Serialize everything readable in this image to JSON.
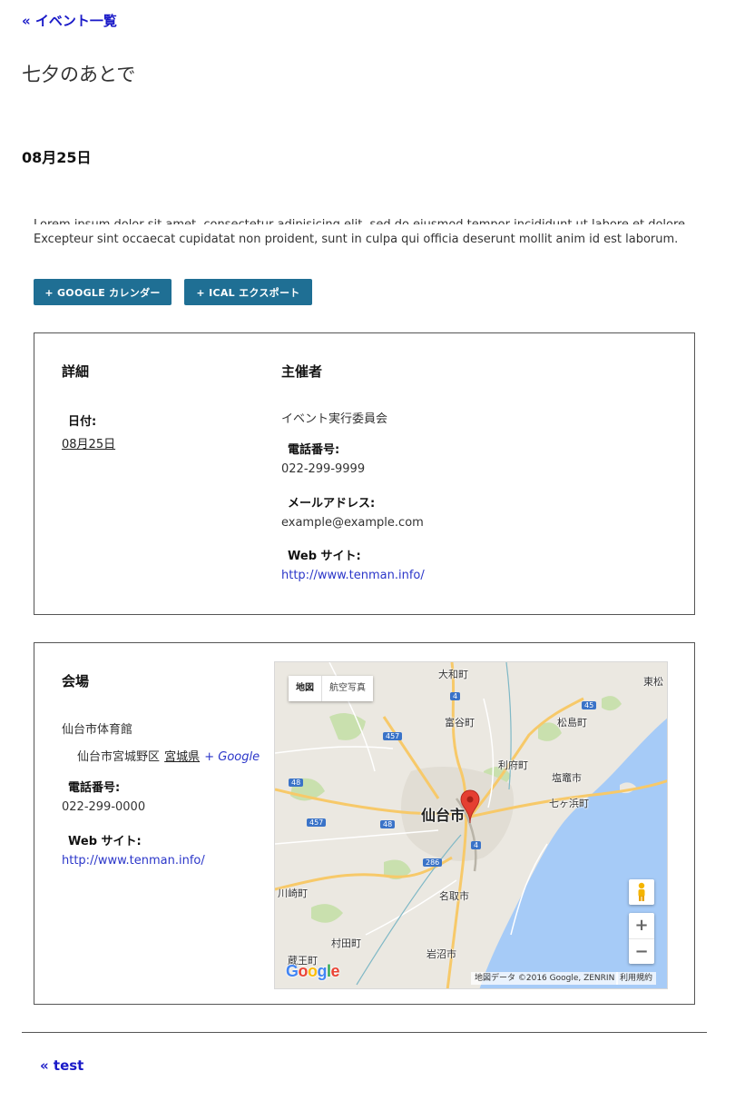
{
  "nav": {
    "back_label": "« イベント一覧",
    "footer_label": "« test"
  },
  "event": {
    "title": "七夕のあとで",
    "date_heading": "08月25日",
    "description_line1": "Lorem ipsum dolor sit amet, consectetur adipisicing elit, sed do eiusmod tempor incididunt ut labore et dolore",
    "description_line2": "Excepteur sint occaecat cupidatat non proident, sunt in culpa qui officia deserunt mollit anim id est laborum."
  },
  "buttons": {
    "gcal": "+ GOOGLE カレンダー",
    "ical": "+ ICAL エクスポート"
  },
  "details": {
    "heading": "詳細",
    "date_label": "日付:",
    "date_value": "08月25日"
  },
  "organizer": {
    "heading": "主催者",
    "name": "イベント実行委員会",
    "phone_label": "電話番号:",
    "phone": "022-299-9999",
    "email_label": "メールアドレス:",
    "email": "example@example.com",
    "website_label": "Web サイト:",
    "website": "http://www.tenman.info/"
  },
  "venue": {
    "heading": "会場",
    "name": "仙台市体育館",
    "address": "仙台市宮城野区",
    "prefecture": "宮城県",
    "gmap_link": "+ Google",
    "phone_label": "電話番号:",
    "phone": "022-299-0000",
    "website_label": "Web サイト:",
    "website": "http://www.tenman.info/"
  },
  "map": {
    "type_map": "地図",
    "type_satellite": "航空写真",
    "attribution": "地図データ ©2016 Google, ZENRIN",
    "terms": "利用規約",
    "labels": {
      "owari": "大和町",
      "tomiya": "富谷町",
      "higashimatsushima": "東松",
      "matsushima": "松島町",
      "rifu": "利府町",
      "shiogama": "塩竈市",
      "shichigahama": "七ヶ浜町",
      "sendai": "仙台市",
      "natori": "名取市",
      "kawasaki": "川崎町",
      "murata": "村田町",
      "zao": "蔵王町",
      "iwanuma": "岩沼市"
    },
    "route_numbers": [
      "4",
      "45",
      "457",
      "48",
      "457",
      "48",
      "286",
      "4"
    ],
    "colors": {
      "water": "#a6cbf7",
      "land": "#ebe8e1",
      "road_major": "#f7c969",
      "road_minor": "#ffffff",
      "green": "#c4dfa8",
      "pin": "#e53f32"
    }
  }
}
